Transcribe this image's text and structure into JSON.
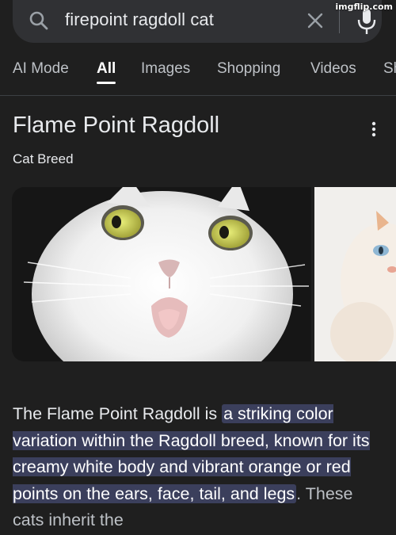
{
  "watermark": "imgflip.com",
  "search": {
    "query": "firepoint ragdoll cat"
  },
  "tabs": [
    {
      "label": "AI Mode"
    },
    {
      "label": "All"
    },
    {
      "label": "Images"
    },
    {
      "label": "Shopping"
    },
    {
      "label": "Videos"
    },
    {
      "label": "Sh"
    }
  ],
  "knowledge_panel": {
    "title": "Flame Point Ragdoll",
    "subtitle": "Cat Breed",
    "description": {
      "prefix": "The Flame Point Ragdoll is ",
      "highlight": "a striking color variation within the Ragdoll breed, known for its creamy white body and vibrant orange or red points on the ears, face, tail, and legs",
      "suffix": ". These cats inherit the"
    }
  },
  "colors": {
    "background": "#1f1f1f",
    "search_bar": "#303134",
    "highlight": "#3b3f5c"
  },
  "icons": [
    "search-icon",
    "clear-icon",
    "mic-icon",
    "more-vert-icon"
  ]
}
